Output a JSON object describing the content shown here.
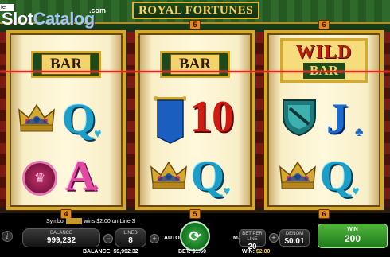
{
  "watermark": {
    "logo_text_a": "Slot",
    "logo_text_b": "Catalog",
    "logo_suffix": ".com",
    "corner_tag": "te"
  },
  "game": {
    "title": "ROYAL FORTUNES"
  },
  "reels": {
    "top_numbers": [
      "5",
      "6"
    ],
    "bottom_numbers": [
      "4",
      "5",
      "6"
    ],
    "reel1": {
      "row1": "BAR",
      "row2_card": "Q",
      "row3_card": "A"
    },
    "reel2": {
      "row1": "BAR",
      "row2_card": "10",
      "row3_card": "Q"
    },
    "reel3": {
      "row1_top": "WILD",
      "row1_bottom": "BAR",
      "row2_card": "J",
      "row3_card": "Q"
    }
  },
  "info": {
    "prefix": "Symbol",
    "message": "wins $2.00 on Line 3"
  },
  "controls": {
    "info_icon": "i",
    "balance_label": "BALANCE",
    "balance_value": "999,232",
    "lines_label": "LINES",
    "lines_value": "8",
    "auto_label": "AUTO",
    "max_label": "MAX",
    "bet_per_line_label": "BET PER LINE",
    "bet_per_line_value": "20",
    "denom_label": "DENOM",
    "denom_value": "$0.01",
    "win_label": "WIN",
    "win_value": "200",
    "minus": "−",
    "plus": "+"
  },
  "footer": {
    "balance_label": "BALANCE:",
    "balance_value": "$9,992.32",
    "bet_label": "BET:",
    "bet_value": "$1.60",
    "win_label": "WIN:",
    "win_value": "$2.00"
  },
  "colors": {
    "payline": "#d8261d",
    "gold": "#d4a92e",
    "win_green": "#4fb53a"
  }
}
